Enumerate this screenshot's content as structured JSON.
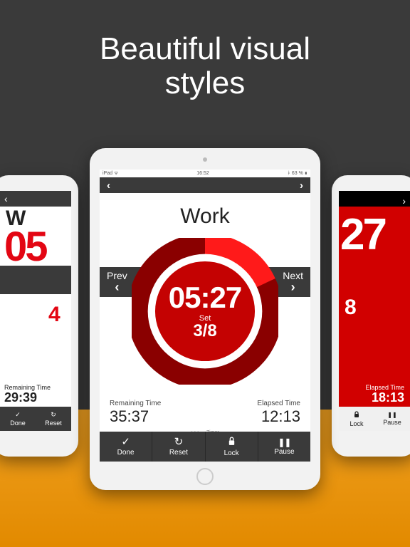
{
  "headline_line1": "Beautiful visual",
  "headline_line2": "styles",
  "center": {
    "status": {
      "left": "iPad ᯤ",
      "center": "16:52",
      "right": "ᚼ 63 % ▮"
    },
    "topbar": {
      "back": "‹",
      "fwd": "›"
    },
    "title": "Work",
    "nav": {
      "prev": "Prev",
      "next": "Next"
    },
    "timer": "05:27",
    "set_label": "Set",
    "set_value": "3/8",
    "remaining_label": "Remaining Time",
    "remaining_value": "35:37",
    "elapsed_label": "Elapsed Time",
    "elapsed_value": "12:13",
    "page_dots": "• • • ◦ ◦  Timer",
    "buttons": {
      "done": "Done",
      "reset": "Reset",
      "lock": "Lock",
      "pause": "Pause"
    }
  },
  "left": {
    "title_frag": "W",
    "big": "05",
    "sub": "4",
    "remaining_label": "Remaining Time",
    "remaining_value": "29:39",
    "buttons": {
      "done": "Done",
      "reset": "Reset"
    }
  },
  "right": {
    "big": "27",
    "sub": "8",
    "elapsed_label": "Elapsed Time",
    "elapsed_value": "18:13",
    "buttons": {
      "lock": "Lock",
      "pause": "Pause"
    }
  },
  "icons": {
    "check": "✓",
    "reset": "↻",
    "lock_body": "▬",
    "pause": "❚❚",
    "chevron_left": "‹",
    "chevron_right": "›"
  }
}
